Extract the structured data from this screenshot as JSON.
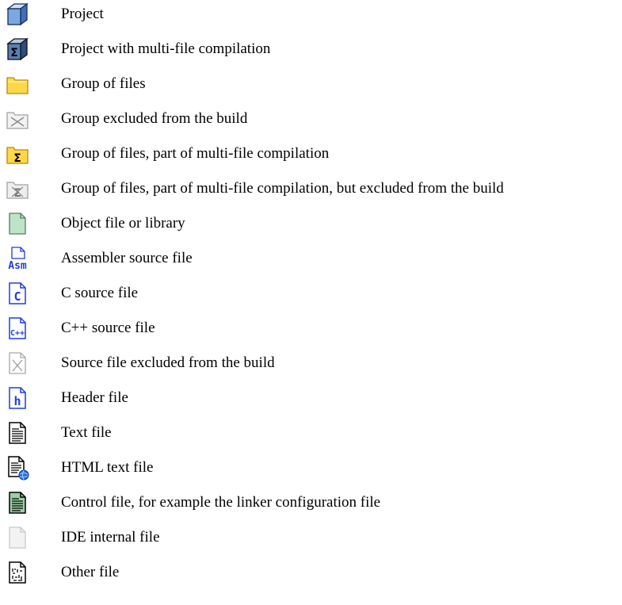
{
  "legend": {
    "items": [
      {
        "icon": "project-icon",
        "label": "Project"
      },
      {
        "icon": "project-multifile-icon",
        "label": "Project with multi-file compilation"
      },
      {
        "icon": "folder-icon",
        "label": "Group of files"
      },
      {
        "icon": "folder-excluded-icon",
        "label": "Group excluded from the build"
      },
      {
        "icon": "folder-multifile-icon",
        "label": "Group of files, part of multi-file compilation"
      },
      {
        "icon": "folder-multifile-excluded-icon",
        "label": "Group of files, part of multi-file compilation, but excluded from the build"
      },
      {
        "icon": "object-file-icon",
        "label": "Object file or library"
      },
      {
        "icon": "assembler-file-icon",
        "label": "Assembler source file"
      },
      {
        "icon": "c-file-icon",
        "label": "C source file"
      },
      {
        "icon": "cpp-file-icon",
        "label": "C++ source file"
      },
      {
        "icon": "file-excluded-icon",
        "label": "Source file excluded from the build"
      },
      {
        "icon": "header-file-icon",
        "label": "Header file"
      },
      {
        "icon": "text-file-icon",
        "label": "Text file"
      },
      {
        "icon": "html-file-icon",
        "label": "HTML text file"
      },
      {
        "icon": "control-file-icon",
        "label": "Control file, for example the linker configuration file"
      },
      {
        "icon": "ide-internal-file-icon",
        "label": "IDE internal file"
      },
      {
        "icon": "other-file-icon",
        "label": "Other file"
      }
    ]
  },
  "icon_text": {
    "sigma": "Σ",
    "asm_line1": "Asm",
    "c": "C",
    "cpp": "C++",
    "h": "h"
  },
  "colors": {
    "project_blue": "#7aa8e0",
    "folder_yellow": "#ffd84a",
    "object_green": "#bfe3c6",
    "source_blue": "#1f3fd8",
    "control_green": "#9ad0a4",
    "ide_gray": "#e6e6e6"
  }
}
